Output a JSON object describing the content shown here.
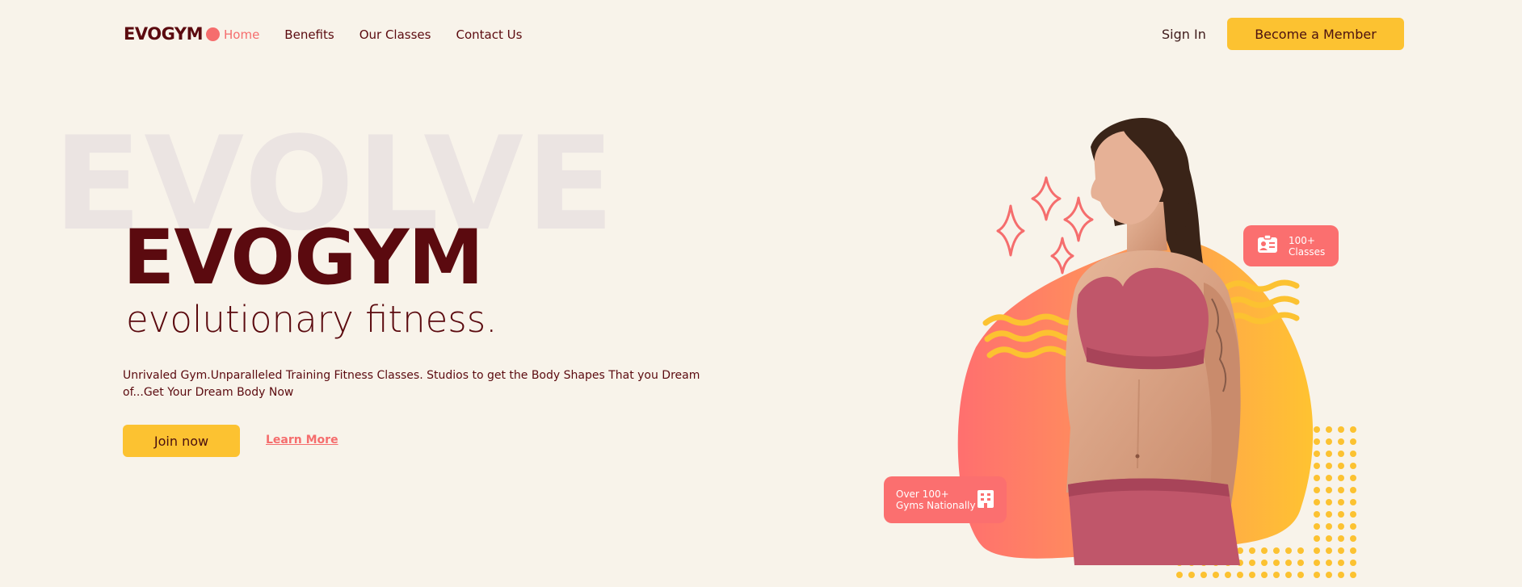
{
  "nav": {
    "logo": "EVOGYM",
    "links": [
      "Home",
      "Benefits",
      "Our Classes",
      "Contact Us"
    ],
    "active": "Home",
    "sign_in": "Sign In",
    "member_button": "Become a Member"
  },
  "hero": {
    "background_word": "EVOLVE",
    "title": "EVOGYM",
    "tagline": "evolutionary fitness.",
    "description": "Unrivaled Gym.Unparalleled Training Fitness Classes. Studios to get the Body Shapes That you Dream of...Get Your Dream Body Now",
    "join_button": "Join now",
    "learn_more": "Learn More"
  },
  "badges": {
    "classes": {
      "line1": "100+",
      "line2": "Classes",
      "icon": "id-card-icon"
    },
    "gyms": {
      "line1": "Over 100+",
      "line2": "Gyms Nationally",
      "icon": "building-icon"
    }
  },
  "colors": {
    "background": "#f8f3ea",
    "primary_text": "#5b0a0f",
    "accent_coral": "#f56d6d",
    "accent_yellow": "#fcc231"
  }
}
